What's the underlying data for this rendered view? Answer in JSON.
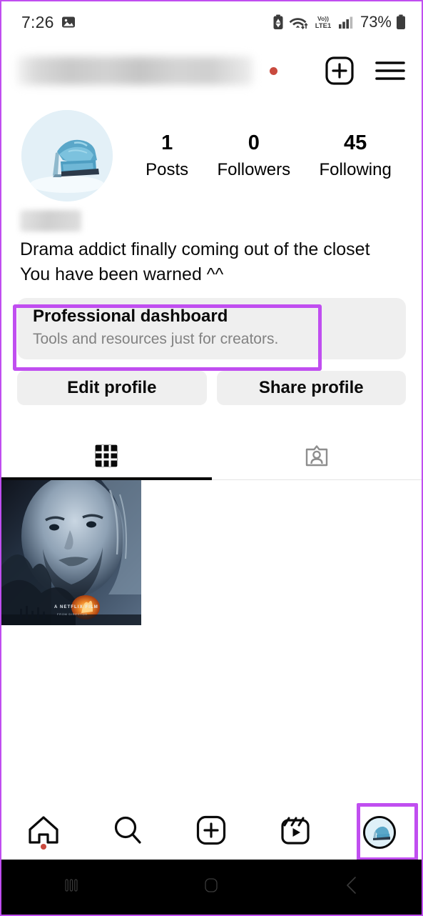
{
  "status_bar": {
    "time": "7:26",
    "battery_percent": "73%",
    "icons": [
      "image-icon",
      "battery-saver-icon",
      "wifi-data-icon",
      "volte1-icon",
      "signal-bars-icon",
      "battery-icon"
    ],
    "network_label": "Vo))",
    "network_sublabel": "LTE1"
  },
  "header": {
    "username_redacted": "",
    "notification_dot": true,
    "icons": [
      "new-post-icon",
      "menu-icon"
    ]
  },
  "profile": {
    "avatar_alt": "blue denim high heel sandal",
    "display_name_redacted": "",
    "bio_lines": [
      "Drama addict finally coming out of the closet",
      "You have been warned ^^"
    ],
    "stats": [
      {
        "count": "1",
        "label": "Posts"
      },
      {
        "count": "0",
        "label": "Followers"
      },
      {
        "count": "45",
        "label": "Following"
      }
    ]
  },
  "dashboard_card": {
    "title": "Professional dashboard",
    "subtitle": "Tools and resources just for creators."
  },
  "actions": {
    "edit_profile": "Edit profile",
    "share_profile": "Share profile"
  },
  "tabs": [
    {
      "name": "grid-tab",
      "icon": "grid-icon",
      "active": true
    },
    {
      "name": "tagged-tab",
      "icon": "tagged-person-icon",
      "active": false
    }
  ],
  "grid_posts": [
    {
      "alt": "dark blue movie poster of bearded man",
      "caption": "A NETFLIX FILM"
    }
  ],
  "bottom_nav": [
    {
      "name": "home-tab",
      "icon": "home-icon",
      "badge": true
    },
    {
      "name": "search-tab",
      "icon": "search-icon",
      "badge": false
    },
    {
      "name": "create-tab",
      "icon": "plus-square-icon",
      "badge": false
    },
    {
      "name": "reels-tab",
      "icon": "reels-icon",
      "badge": false
    },
    {
      "name": "profile-tab",
      "icon": "profile-avatar-icon",
      "badge": false
    }
  ],
  "android_nav": [
    {
      "name": "recents-button",
      "icon": "recents-icon"
    },
    {
      "name": "home-button",
      "icon": "home-square-icon"
    },
    {
      "name": "back-button",
      "icon": "back-chevron-icon"
    }
  ],
  "annotations": {
    "highlight_color": "#c04ef0",
    "boxes": [
      "professional-dashboard-highlight",
      "profile-tab-highlight"
    ]
  }
}
